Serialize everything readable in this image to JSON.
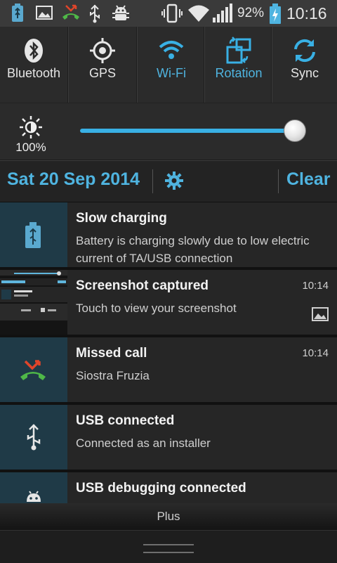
{
  "status_bar": {
    "battery_percent": "92%",
    "time": "10:16",
    "left_icons": [
      "battery-charging-notification-icon",
      "image-icon",
      "missed-call-icon",
      "usb-icon",
      "android-debug-icon"
    ],
    "right_icons": [
      "vibrate-icon",
      "wifi-icon",
      "signal-icon",
      "battery-charging-icon"
    ]
  },
  "quick_settings": [
    {
      "label": "Bluetooth",
      "icon": "bluetooth-icon",
      "active": false
    },
    {
      "label": "GPS",
      "icon": "gps-icon",
      "active": false
    },
    {
      "label": "Wi-Fi",
      "icon": "wifi-icon",
      "active": true
    },
    {
      "label": "Rotation",
      "icon": "rotation-icon",
      "active": true
    },
    {
      "label": "Sync",
      "icon": "sync-icon",
      "active": true
    }
  ],
  "brightness": {
    "percent_label": "100%",
    "level": 1.0
  },
  "date_bar": {
    "date": "Sat 20 Sep 2014",
    "clear_label": "Clear"
  },
  "notifications": [
    {
      "title": "Slow charging",
      "text": "Battery is charging slowly due to low electric current of TA/USB connection",
      "time": ""
    },
    {
      "title": "Screenshot captured",
      "text": "Touch to view your screenshot",
      "time": "10:14"
    },
    {
      "title": "Missed call",
      "text": "Siostra Fruzia",
      "time": "10:14"
    },
    {
      "title": "USB connected",
      "text": "Connected as an installer",
      "time": ""
    },
    {
      "title": "USB debugging connected",
      "text": "",
      "time": ""
    }
  ],
  "carrier_label": "Plus",
  "colors": {
    "accent": "#4fb4e0",
    "inactive_text": "#e6e6e6",
    "thumb_bg": "#1f3a47"
  }
}
